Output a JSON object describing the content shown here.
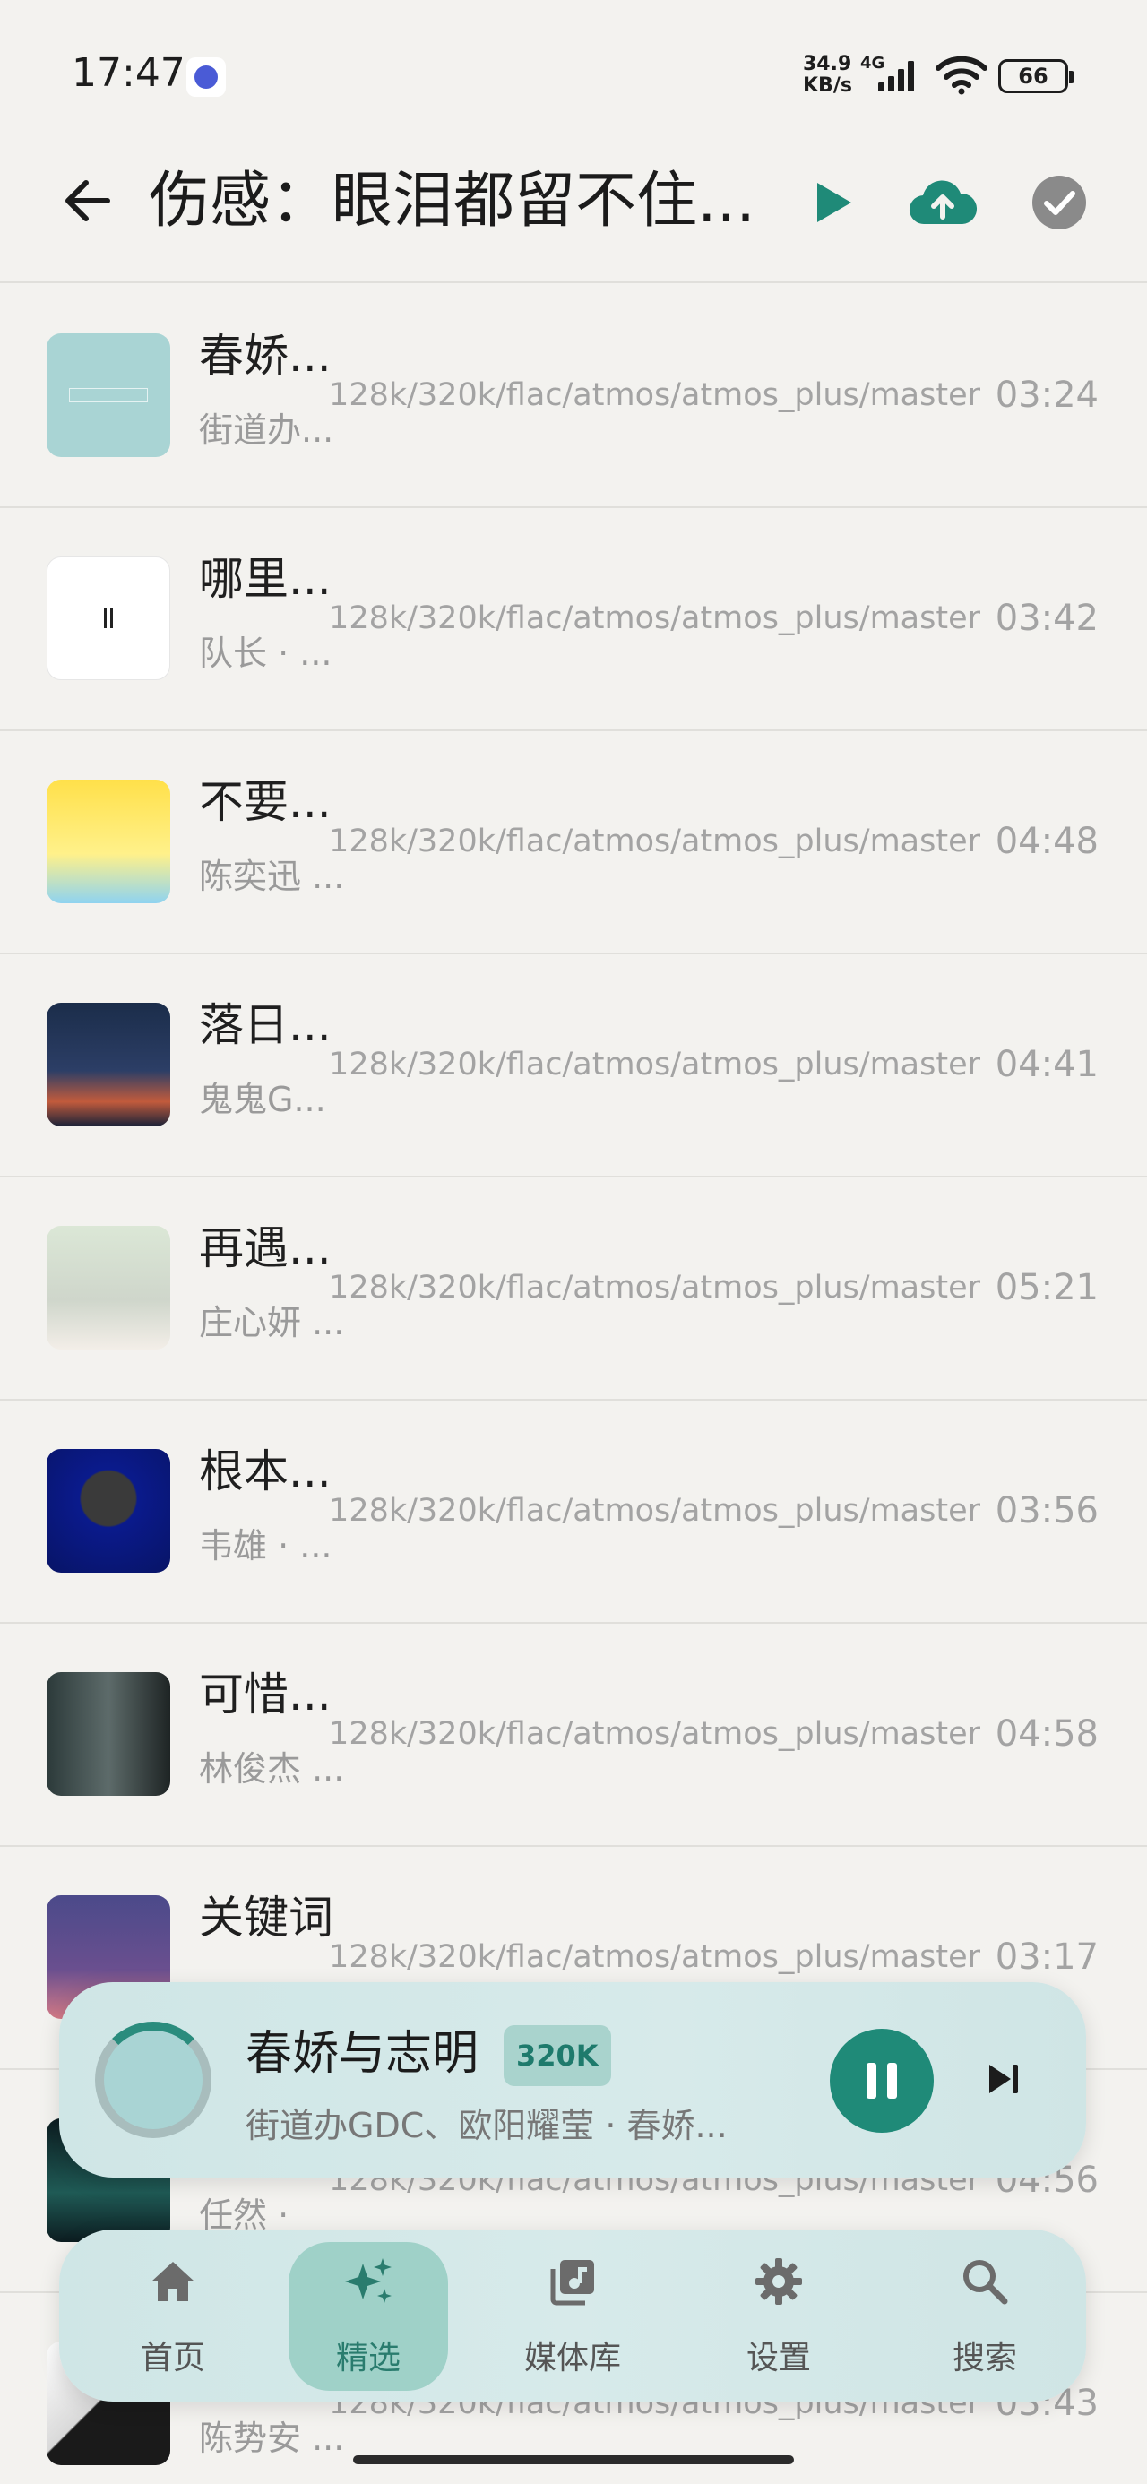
{
  "status_bar": {
    "time": "17:47",
    "net_speed_value": "34.9",
    "net_speed_unit": "KB/s",
    "network": "4G",
    "battery": "66"
  },
  "header": {
    "title": "伤感：眼泪都留不住...",
    "accent_color": "#1f8a78"
  },
  "songs": [
    {
      "title": "春娇...",
      "artist": "街道办...",
      "quality": "128k/320k/flac/atmos/atmos_plus/master",
      "duration": "03:24"
    },
    {
      "title": "哪里...",
      "artist": "队长 · ...",
      "quality": "128k/320k/flac/atmos/atmos_plus/master",
      "duration": "03:42"
    },
    {
      "title": "不要...",
      "artist": "陈奕迅 ...",
      "quality": "128k/320k/flac/atmos/atmos_plus/master",
      "duration": "04:48"
    },
    {
      "title": "落日...",
      "artist": "鬼鬼G...",
      "quality": "128k/320k/flac/atmos/atmos_plus/master",
      "duration": "04:41"
    },
    {
      "title": "再遇...",
      "artist": "庄心妍 ...",
      "quality": "128k/320k/flac/atmos/atmos_plus/master",
      "duration": "05:21"
    },
    {
      "title": "根本...",
      "artist": "韦雄 · ...",
      "quality": "128k/320k/flac/atmos/atmos_plus/master",
      "duration": "03:56"
    },
    {
      "title": "可惜...",
      "artist": "林俊杰 ...",
      "quality": "128k/320k/flac/atmos/atmos_plus/master",
      "duration": "04:58"
    },
    {
      "title": "关键词",
      "artist": "",
      "quality": "128k/320k/flac/atmos/atmos_plus/master",
      "duration": "03:17"
    },
    {
      "title": "",
      "artist": "任然 ·",
      "quality": "128k/320k/flac/atmos/atmos_plus/master",
      "duration": "04:56"
    },
    {
      "title": "",
      "artist": "陈势安 ...",
      "quality": "128k/320k/flac/atmos/atmos_plus/master",
      "duration": "03:43"
    }
  ],
  "now_playing": {
    "title": "春娇与志明",
    "quality_badge": "320K",
    "artist": "街道办GDC、欧阳耀莹 · 春娇...",
    "progress": 0.15
  },
  "bottom_nav": {
    "items": [
      {
        "label": "首页",
        "icon": "home-icon"
      },
      {
        "label": "精选",
        "icon": "sparkle-icon",
        "active": true
      },
      {
        "label": "媒体库",
        "icon": "library-icon"
      },
      {
        "label": "设置",
        "icon": "gear-icon"
      },
      {
        "label": "搜索",
        "icon": "search-icon"
      }
    ]
  }
}
